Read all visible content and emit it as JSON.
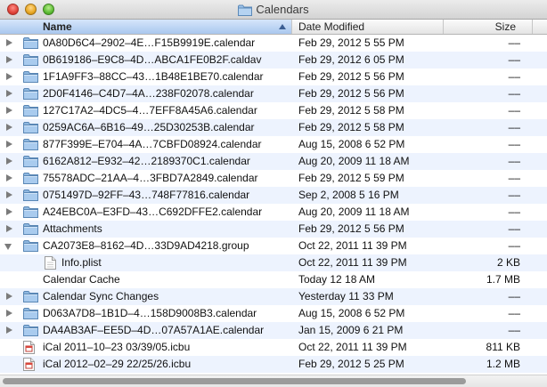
{
  "window": {
    "title": "Calendars"
  },
  "columns": {
    "name": "Name",
    "date_modified": "Date Modified",
    "size": "Size"
  },
  "rows": [
    {
      "name": "0A80D6C4–2902–4E…F15B9919E.calendar",
      "date": "Feb 29, 2012 5 55 PM",
      "size": "––",
      "type": "folder",
      "disclosure": "closed",
      "indent": 0
    },
    {
      "name": "0B619186–E9C8–4D…ABCA1FE0B2F.caldav",
      "date": "Feb 29, 2012 6 05 PM",
      "size": "––",
      "type": "folder",
      "disclosure": "closed",
      "indent": 0
    },
    {
      "name": "1F1A9FF3–88CC–43…1B48E1BE70.calendar",
      "date": "Feb 29, 2012 5 56 PM",
      "size": "––",
      "type": "folder",
      "disclosure": "closed",
      "indent": 0
    },
    {
      "name": "2D0F4146–C4D7–4A…238F02078.calendar",
      "date": "Feb 29, 2012 5 56 PM",
      "size": "––",
      "type": "folder",
      "disclosure": "closed",
      "indent": 0
    },
    {
      "name": "127C17A2–4DC5–4…7EFF8A45A6.calendar",
      "date": "Feb 29, 2012 5 58 PM",
      "size": "––",
      "type": "folder",
      "disclosure": "closed",
      "indent": 0
    },
    {
      "name": "0259AC6A–6B16–49…25D30253B.calendar",
      "date": "Feb 29, 2012 5 58 PM",
      "size": "––",
      "type": "folder",
      "disclosure": "closed",
      "indent": 0
    },
    {
      "name": "877F399E–E704–4A…7CBFD08924.calendar",
      "date": "Aug 15, 2008 6 52 PM",
      "size": "––",
      "type": "folder",
      "disclosure": "closed",
      "indent": 0
    },
    {
      "name": "6162A812–E932–42…2189370C1.calendar",
      "date": "Aug 20, 2009 11 18 AM",
      "size": "––",
      "type": "folder",
      "disclosure": "closed",
      "indent": 0
    },
    {
      "name": "75578ADC–21AA–4…3FBD7A2849.calendar",
      "date": "Feb 29, 2012 5 59 PM",
      "size": "––",
      "type": "folder",
      "disclosure": "closed",
      "indent": 0
    },
    {
      "name": "0751497D–92FF–43…748F77816.calendar",
      "date": "Sep 2, 2008 5 16 PM",
      "size": "––",
      "type": "folder",
      "disclosure": "closed",
      "indent": 0
    },
    {
      "name": "A24EBC0A–E3FD–43…C692DFFE2.calendar",
      "date": "Aug 20, 2009 11 18 AM",
      "size": "––",
      "type": "folder",
      "disclosure": "closed",
      "indent": 0
    },
    {
      "name": "Attachments",
      "date": "Feb 29, 2012 5 56 PM",
      "size": "––",
      "type": "folder",
      "disclosure": "closed",
      "indent": 0
    },
    {
      "name": "CA2073E8–8162–4D…33D9AD4218.group",
      "date": "Oct 22, 2011 11 39 PM",
      "size": "––",
      "type": "folder",
      "disclosure": "open",
      "indent": 0
    },
    {
      "name": "Info.plist",
      "date": "Oct 22, 2011 11 39 PM",
      "size": "2 KB",
      "type": "file",
      "disclosure": "none",
      "indent": 1
    },
    {
      "name": "Calendar Cache",
      "date": "Today 12 18 AM",
      "size": "1.7 MB",
      "type": "none",
      "disclosure": "none",
      "indent": 0
    },
    {
      "name": "Calendar Sync Changes",
      "date": "Yesterday 11 33 PM",
      "size": "––",
      "type": "folder",
      "disclosure": "closed",
      "indent": 0
    },
    {
      "name": "D063A7D8–1B1D–4…158D9008B3.calendar",
      "date": "Aug 15, 2008 6 52 PM",
      "size": "––",
      "type": "folder",
      "disclosure": "closed",
      "indent": 0
    },
    {
      "name": "DA4AB3AF–EE5D–4D…07A57A1AE.calendar",
      "date": "Jan 15, 2009 6 21 PM",
      "size": "––",
      "type": "folder",
      "disclosure": "closed",
      "indent": 0
    },
    {
      "name": "iCal 2011–10–23 03/39/05.icbu",
      "date": "Oct 22, 2011 11 39 PM",
      "size": "811 KB",
      "type": "icbu",
      "disclosure": "none",
      "indent": 0
    },
    {
      "name": "iCal 2012–02–29 22/25/26.icbu",
      "date": "Feb 29, 2012 5 25 PM",
      "size": "1.2 MB",
      "type": "icbu",
      "disclosure": "none",
      "indent": 0
    }
  ],
  "icons": {
    "folder": "folder-icon",
    "file": "document-icon",
    "icbu": "ical-backup-icon"
  },
  "colors": {
    "row_alt": "#edf3fe",
    "header_sorted": "#a9c7ee",
    "folder_blue": "#8fb8e0"
  }
}
